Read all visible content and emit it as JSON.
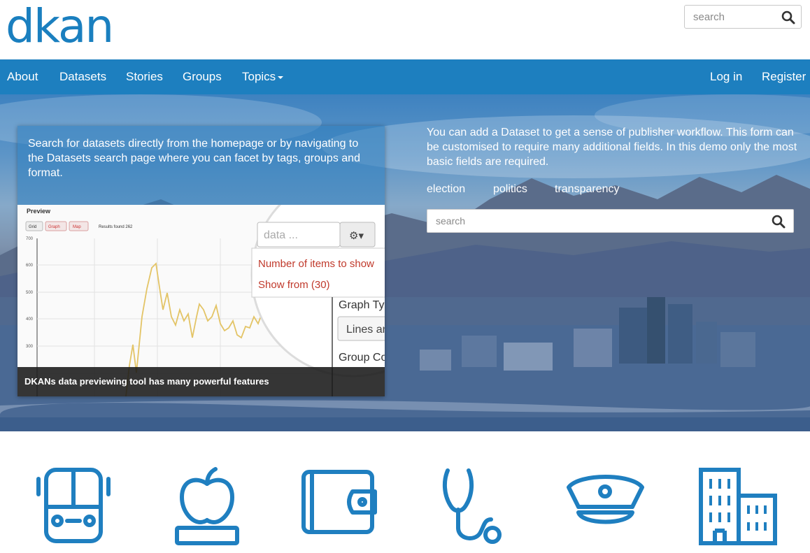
{
  "brand": {
    "logo_text": "dkan",
    "color": "#1a7fbf"
  },
  "header": {
    "search_placeholder": "search",
    "search_icon": "magnifier-icon"
  },
  "nav": {
    "background": "#1d7fbf",
    "items": [
      {
        "label": "About"
      },
      {
        "label": "Datasets"
      },
      {
        "label": "Stories"
      },
      {
        "label": "Groups"
      },
      {
        "label": "Topics",
        "dropdown": true
      }
    ],
    "right": [
      {
        "label": "Log in"
      },
      {
        "label": "Register"
      }
    ]
  },
  "hero": {
    "left_panel": {
      "description": "Search for datasets directly from the homepage or by navigating to the Datasets search page where you can facet by tags, groups and format.",
      "caption": "DKANs data previewing tool has many powerful features",
      "preview": {
        "title": "Preview",
        "view_buttons": [
          "Grid",
          "Graph",
          "Map"
        ],
        "results": "Results found 262",
        "y_ticks": [
          "700",
          "600",
          "500",
          "400",
          "300"
        ],
        "search_placeholder": "data ...",
        "menu_items": [
          "Number of items to show",
          "Show from (30)"
        ],
        "labels": [
          "Graph Type",
          "Lines and",
          "Group Co"
        ]
      }
    },
    "right_panel": {
      "description": "You can add a Dataset to get a sense of publisher workflow. This form can be customised to require many additional fields. In this demo only the most basic fields are required.",
      "tags": [
        "election",
        "politics",
        "transparency"
      ],
      "search_placeholder": "search"
    }
  },
  "topics": {
    "color": "#1f7fc0",
    "icons": [
      "bus-icon",
      "apple-book-icon",
      "wallet-icon",
      "stethoscope-icon",
      "police-hat-icon",
      "city-buildings-icon"
    ]
  }
}
